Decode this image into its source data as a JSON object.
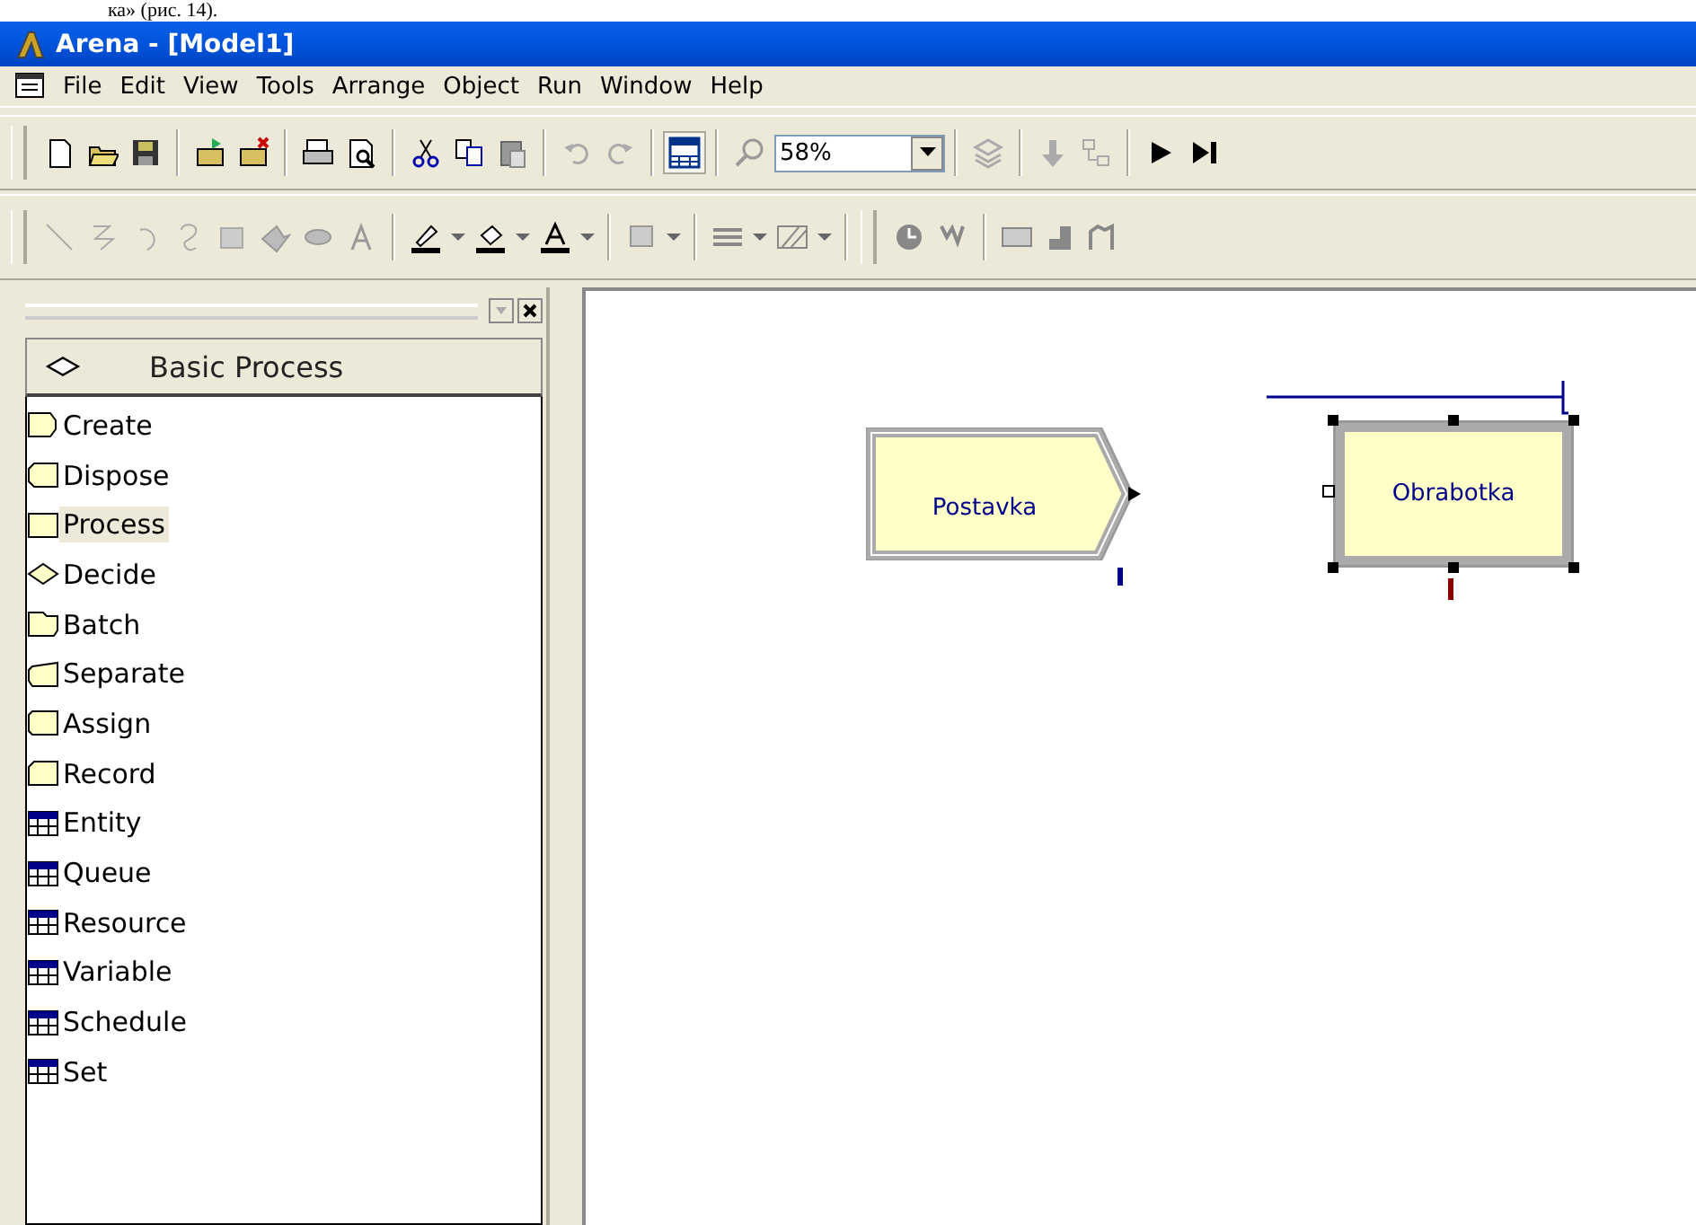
{
  "caption": {
    "text": "ка» (рис. 14)."
  },
  "window": {
    "title": "Arena - [Model1]"
  },
  "menu": [
    "File",
    "Edit",
    "View",
    "Tools",
    "Arrange",
    "Object",
    "Run",
    "Window",
    "Help"
  ],
  "toolbar": {
    "zoom": "58%"
  },
  "panel": {
    "title": "Basic Process",
    "items": [
      {
        "label": "Create",
        "kind": "create",
        "selected": false
      },
      {
        "label": "Dispose",
        "kind": "dispose",
        "selected": false
      },
      {
        "label": "Process",
        "kind": "process",
        "selected": true
      },
      {
        "label": "Decide",
        "kind": "decide",
        "selected": false
      },
      {
        "label": "Batch",
        "kind": "batch",
        "selected": false
      },
      {
        "label": "Separate",
        "kind": "separate",
        "selected": false
      },
      {
        "label": "Assign",
        "kind": "assign",
        "selected": false
      },
      {
        "label": "Record",
        "kind": "record",
        "selected": false
      },
      {
        "label": "Entity",
        "kind": "data",
        "selected": false
      },
      {
        "label": "Queue",
        "kind": "data",
        "selected": false
      },
      {
        "label": "Resource",
        "kind": "data",
        "selected": false
      },
      {
        "label": "Variable",
        "kind": "data",
        "selected": false
      },
      {
        "label": "Schedule",
        "kind": "data",
        "selected": false
      },
      {
        "label": "Set",
        "kind": "data",
        "selected": false
      }
    ]
  },
  "canvas": {
    "modules": [
      {
        "label": "Postavka",
        "kind": "create",
        "selected": false
      },
      {
        "label": "Obrabotka",
        "kind": "process",
        "selected": true
      }
    ]
  }
}
